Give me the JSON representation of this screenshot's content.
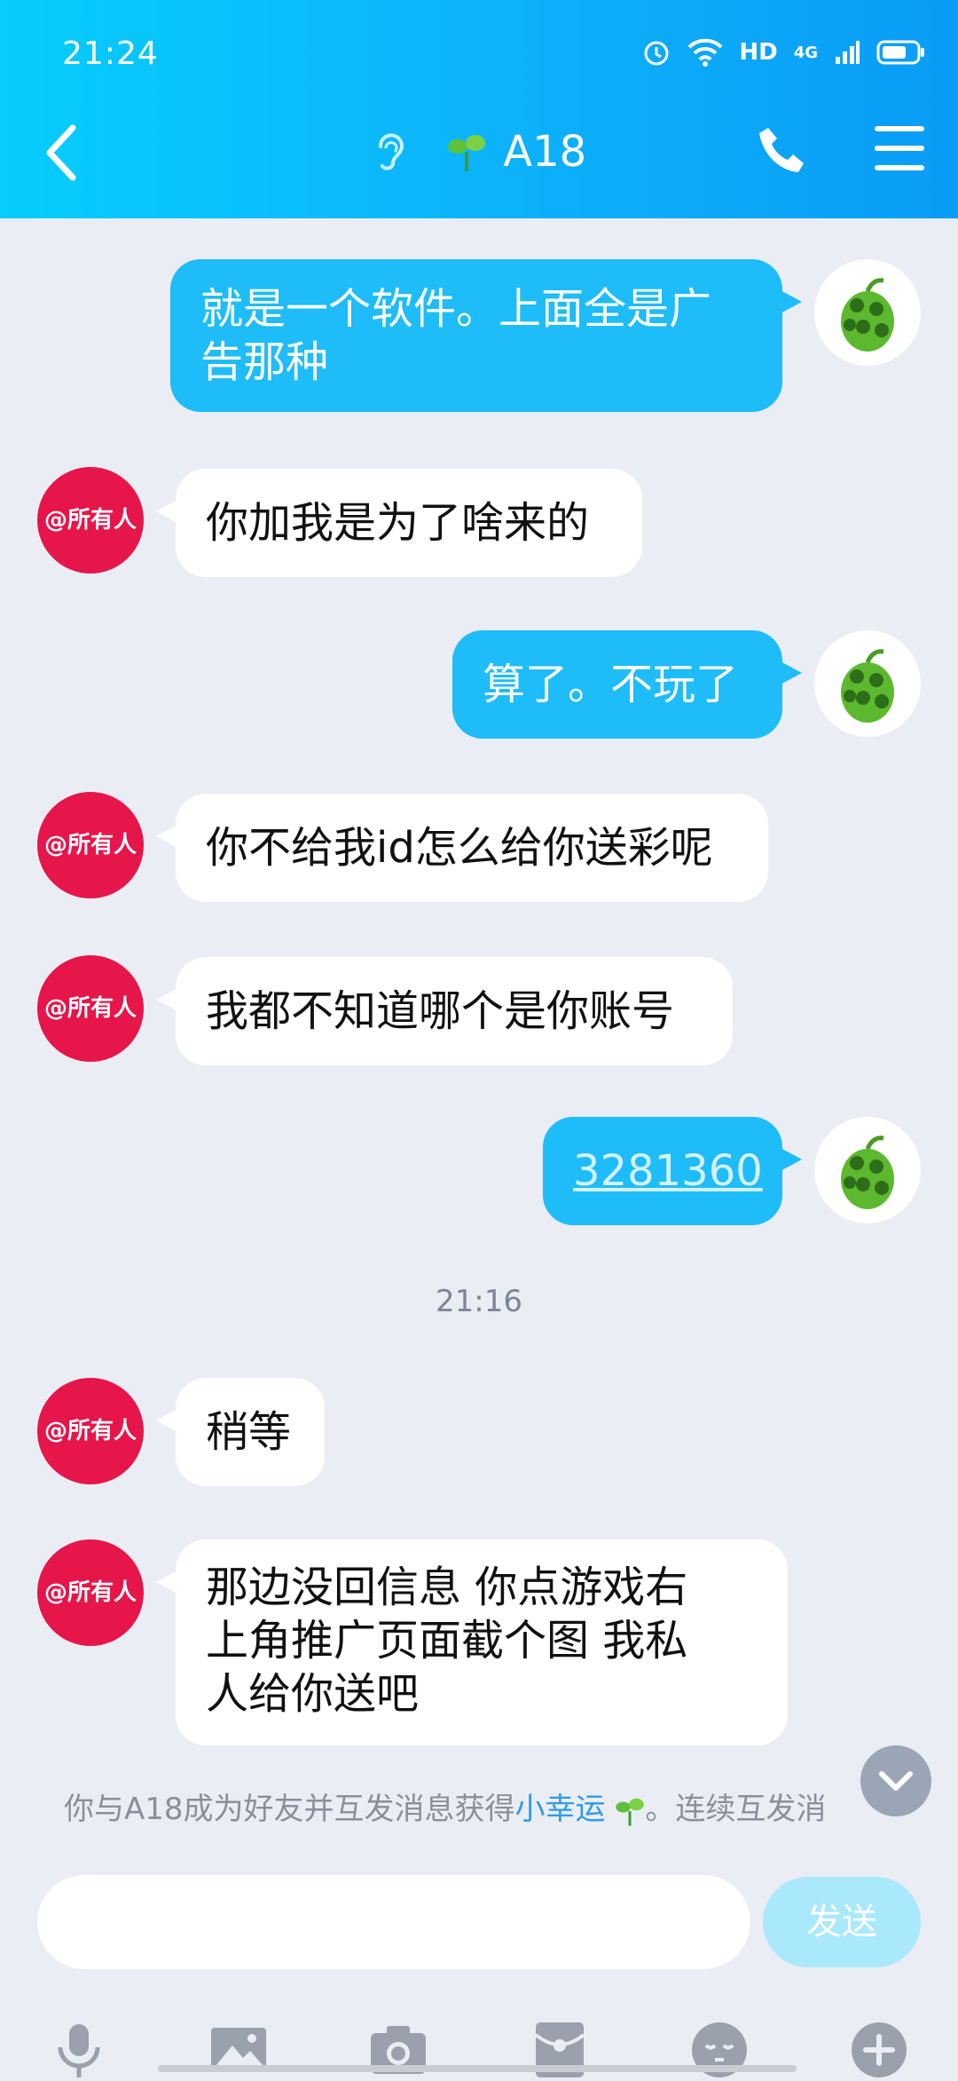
{
  "status_bar": {
    "time": "21:24",
    "network_label": "HD",
    "signal_label": "4G"
  },
  "header": {
    "title": "A18"
  },
  "messages": [
    {
      "side": "out",
      "text_line1": "就是一个软件。上面全是广",
      "text_line2": "告那种"
    },
    {
      "side": "in",
      "text": "你加我是为了啥来的",
      "avatar_label": "@所有人"
    },
    {
      "side": "out",
      "text": "算了。不玩了"
    },
    {
      "side": "in",
      "text": "你不给我id怎么给你送彩呢",
      "avatar_label": "@所有人"
    },
    {
      "side": "in",
      "text": "我都不知道哪个是你账号",
      "avatar_label": "@所有人"
    },
    {
      "side": "out",
      "text": "3281360"
    },
    {
      "side": "in",
      "text": "稍等",
      "avatar_label": "@所有人"
    },
    {
      "side": "in",
      "text_line1": "那边没回信息 你点游戏右",
      "text_line2": "上角推广页面截个图 我私",
      "text_line3": "人给你送吧",
      "avatar_label": "@所有人"
    }
  ],
  "timestamp": "21:16",
  "notice": {
    "prefix": "你与A18成为好友并互发消息获得",
    "lucky": "小幸运",
    "suffix": "。连续互发消"
  },
  "input": {
    "placeholder": "",
    "send_label": "发送"
  },
  "toolbar": [
    "mic-icon",
    "image-icon",
    "camera-icon",
    "red-packet-icon",
    "emoji-icon",
    "plus-icon"
  ],
  "colors": {
    "accent": "#1ebcf9",
    "header_start": "#06cdfc",
    "header_end": "#0a9cf6",
    "avatar_red": "#e6154a",
    "send_disabled": "#a9e9fb"
  }
}
